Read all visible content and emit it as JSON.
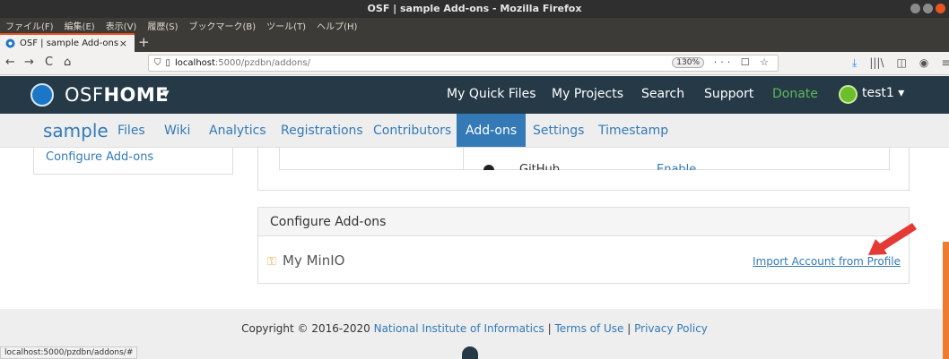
{
  "window": {
    "title": "OSF | sample Add-ons - Mozilla Firefox"
  },
  "menubar": [
    "ファイル(F)",
    "編集(E)",
    "表示(V)",
    "履歴(S)",
    "ブックマーク(B)",
    "ツール(T)",
    "ヘルプ(H)"
  ],
  "tab": {
    "label": "OSF | sample Add-ons",
    "close": "×",
    "new_tab": "+"
  },
  "navbar": {
    "back": "←",
    "forward": "→",
    "reload": "C",
    "home": "⌂",
    "url_host": "localhost",
    "url_path": ":5000/pzdbn/addons/",
    "zoom": "130%",
    "icons": "··· ☐ ☆"
  },
  "osf": {
    "brand_prefix": "OSF",
    "brand_bold": "HOME",
    "caret": "▾",
    "nav": [
      "My Quick Files",
      "My Projects",
      "Search",
      "Support",
      "Donate"
    ],
    "user": "test1 ▾"
  },
  "project_nav": {
    "project": "sample",
    "items": [
      "Files",
      "Wiki",
      "Analytics",
      "Registrations",
      "Contributors",
      "Add-ons",
      "Settings",
      "Timestamp"
    ],
    "active": "Add-ons"
  },
  "left_panel": {
    "link": "Configure Add-ons"
  },
  "addon_list": {
    "name": "GitHub",
    "action": "Enable"
  },
  "configure_panel": {
    "title": "Configure Add-ons",
    "addon_name": "My MinIO",
    "import_link": "Import Account from Profile"
  },
  "footer": {
    "prefix": "Copyright © 2016-2020",
    "nii": "National Institute of Informatics",
    "sep1": " | ",
    "terms": "Terms of Use",
    "sep2": " | ",
    "privacy": "Privacy Policy"
  },
  "status_url": "localhost:5000/pzdbn/addons/#",
  "colors": {
    "osf_nav": "#263947",
    "link": "#337ab7",
    "active_tab": "#337ab7",
    "donate": "#5cb85c",
    "arrow": "#e53935"
  }
}
